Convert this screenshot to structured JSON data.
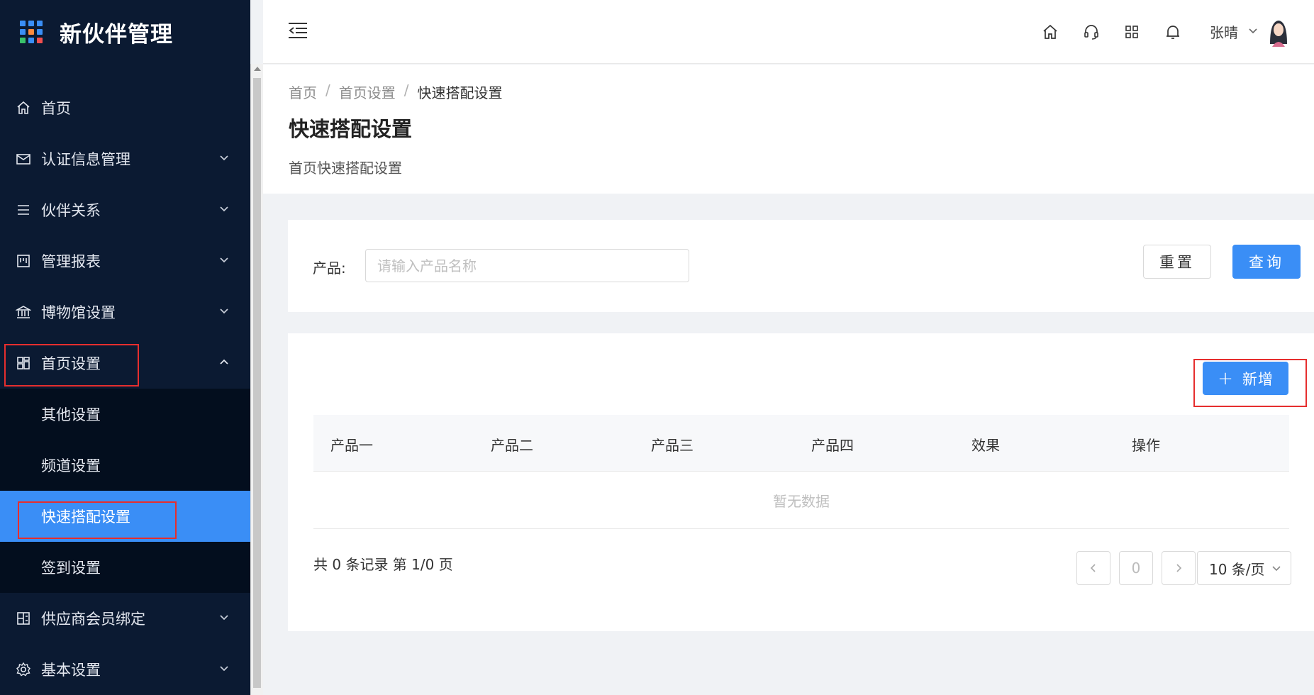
{
  "app": {
    "title": "新伙伴管理"
  },
  "sidebar": {
    "items": [
      {
        "label": "首页",
        "icon": "home-icon"
      },
      {
        "label": "认证信息管理",
        "icon": "mail-icon"
      },
      {
        "label": "伙伴关系",
        "icon": "list-icon"
      },
      {
        "label": "管理报表",
        "icon": "report-icon"
      },
      {
        "label": "博物馆设置",
        "icon": "museum-icon"
      },
      {
        "label": "首页设置",
        "icon": "layout-icon"
      },
      {
        "label": "供应商会员绑定",
        "icon": "binding-icon"
      },
      {
        "label": "基本设置",
        "icon": "gear-icon"
      }
    ],
    "submenu": [
      {
        "label": "其他设置"
      },
      {
        "label": "频道设置"
      },
      {
        "label": "快速搭配设置"
      },
      {
        "label": "签到设置"
      }
    ]
  },
  "header": {
    "user_name": "张晴",
    "icons": [
      "home-icon",
      "headset-icon",
      "apps-icon",
      "bell-icon"
    ]
  },
  "breadcrumb": [
    "首页",
    "首页设置",
    "快速搭配设置"
  ],
  "page": {
    "title": "快速搭配设置",
    "description": "首页快速搭配设置"
  },
  "search": {
    "label": "产品:",
    "placeholder": "请输入产品名称",
    "reset_label": "重置",
    "query_label": "查询"
  },
  "table": {
    "add_label": "新增",
    "columns": [
      "产品一",
      "产品二",
      "产品三",
      "产品四",
      "效果",
      "操作"
    ],
    "empty_text": "暂无数据"
  },
  "pagination": {
    "summary": "共 0 条记录 第 1/0 页",
    "current_page": "0",
    "page_size": "10 条/页"
  },
  "colors": {
    "primary": "#3a8ef6",
    "sidebar_bg": "#0b1a32",
    "highlight": "#e62e2e"
  }
}
